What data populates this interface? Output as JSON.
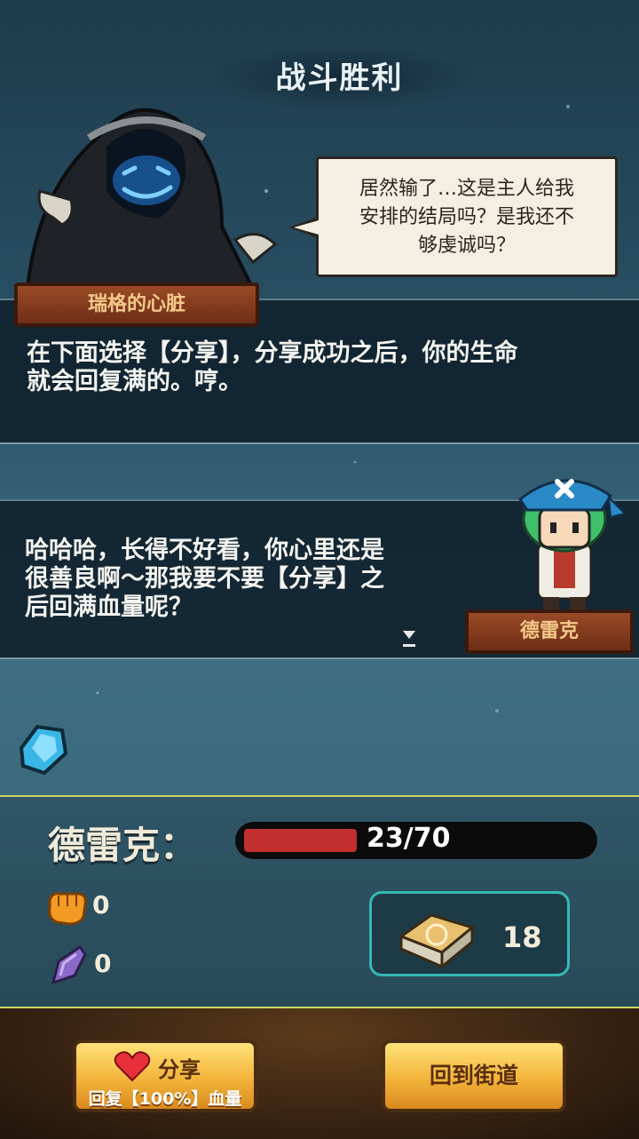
{
  "title": "战斗胜利",
  "villain": {
    "name": "瑞格的心脏",
    "bubble_lines": [
      "居然输了…这是主人给我",
      "安排的结局吗？是我还不",
      "够虔诚吗？"
    ],
    "dialog_lines": [
      "在下面选择【分享】，分享成功之后，你的生命",
      "就会回复满的。哼。"
    ]
  },
  "hero": {
    "name": "德雷克",
    "dialog_lines": [
      "哈哈哈，长得不好看，你心里还是",
      "很善良啊～那我要不要【分享】之",
      "后回满血量呢？"
    ]
  },
  "hud": {
    "name_label": "德雷克：",
    "hp_text": "23/70",
    "hp_fraction": 0.3286,
    "fist_count": "0",
    "gem_count": "0",
    "card_count": "18"
  },
  "buttons": {
    "share_label": "分享",
    "share_sub": "回复【100%】血量",
    "back_label": "回到街道"
  },
  "colors": {
    "hp": "#c22f2f",
    "button": "#f3b43a",
    "accent": "#36b9b4"
  }
}
